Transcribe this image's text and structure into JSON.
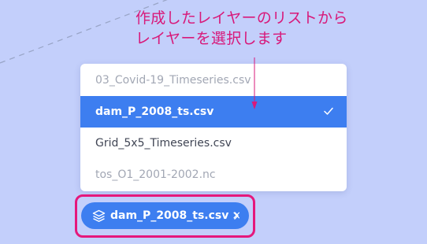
{
  "annotation": {
    "line1": "作成したレイヤーのリストから",
    "line2": "レイヤーを選択します"
  },
  "dropdown": {
    "items": [
      {
        "label": "03_Covid-19_Timeseries.csv",
        "state": "disabled"
      },
      {
        "label": "dam_P_2008_ts.csv",
        "state": "selected"
      },
      {
        "label": "Grid_5x5_Timeseries.csv",
        "state": "normal"
      },
      {
        "label": "tos_O1_2001-2002.nc",
        "state": "disabled"
      }
    ]
  },
  "layer_chip": {
    "label": "dam_P_2008_ts.csv",
    "close_glyph": "×"
  },
  "icons": {
    "layer": "layers-icon",
    "check": "checkmark-icon",
    "close": "close-icon",
    "expand": "chevron-right-icon"
  },
  "colors": {
    "background": "#c3cffb",
    "accent": "#3d7ef0",
    "annotation": "#d8197a",
    "highlight_border": "#e5187c",
    "muted_text": "#a2a7b4"
  }
}
